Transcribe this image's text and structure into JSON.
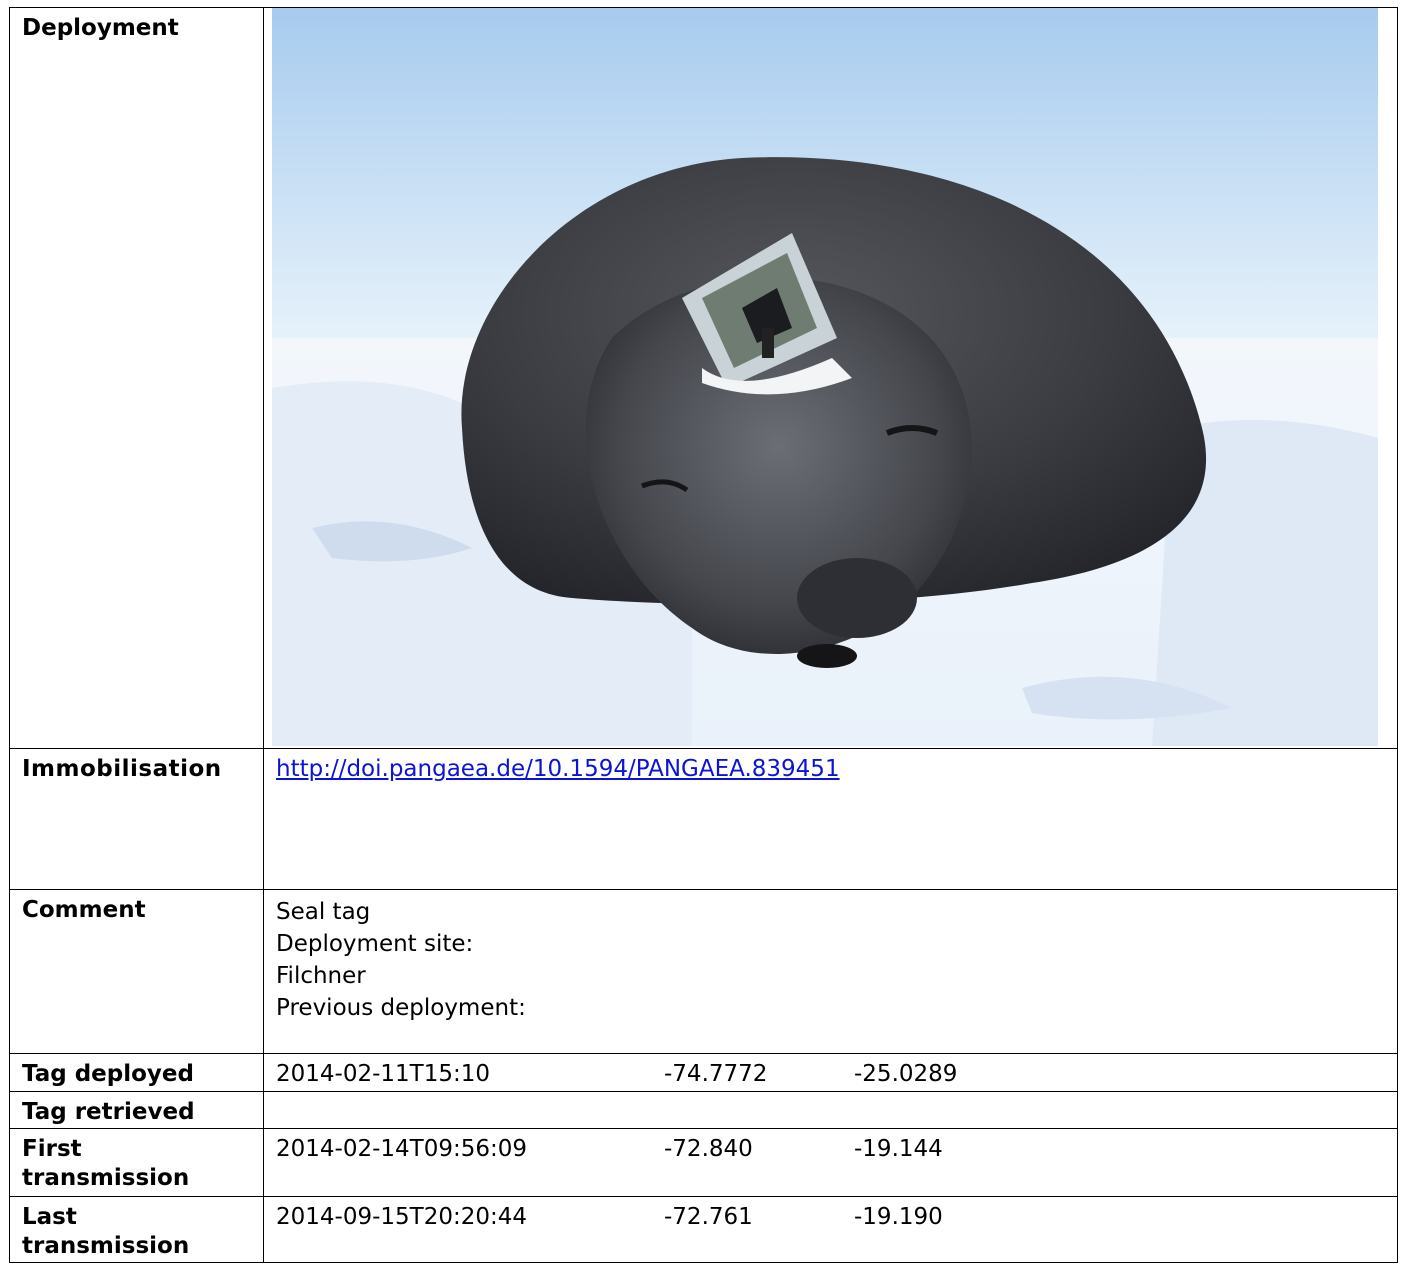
{
  "rows": {
    "deployment_label": "Deployment",
    "immobilisation_label": "Immobilisation",
    "immobilisation_link": "http://doi.pangaea.de/10.1594/PANGAEA.839451",
    "comment_label": "Comment",
    "comment_lines": [
      "Seal tag",
      "Deployment site:",
      "Filchner",
      "Previous deployment:"
    ],
    "tag_deployed_label": "Tag deployed",
    "tag_deployed": {
      "time": "2014-02-11T15:10",
      "lat": "-74.7772",
      "lon": "-25.0289"
    },
    "tag_retrieved_label": "Tag retrieved",
    "first_tx_label_1": "First",
    "first_tx_label_2": "transmission",
    "first_tx": {
      "time": "2014-02-14T09:56:09",
      "lat": "-72.840",
      "lon": "-19.144"
    },
    "last_tx_label_1": "Last",
    "last_tx_label_2": "transmission",
    "last_tx": {
      "time": "2014-09-15T20:20:44",
      "lat": "-72.761",
      "lon": "-19.190"
    }
  },
  "colors": {
    "sky_top": "#a9cdef",
    "sky_bottom": "#e6f2fb",
    "snow": "#f4f8fc",
    "seal": "#3e3f44",
    "link": "#0b13d8"
  }
}
